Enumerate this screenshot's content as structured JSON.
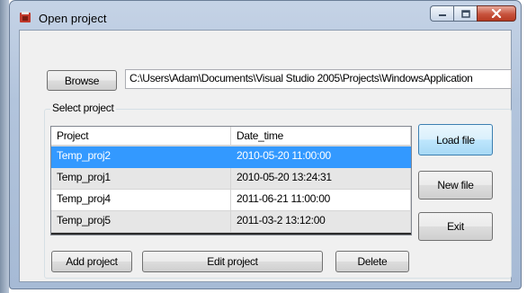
{
  "window": {
    "title": "Open project",
    "icon": "app-icon",
    "minimize_glyph": "–",
    "maximize_glyph": "□",
    "close_glyph": "✕"
  },
  "browse": {
    "button_label": "Browse",
    "path_value": "C:\\Users\\Adam\\Documents\\Visual Studio 2005\\Projects\\WindowsApplication"
  },
  "group": {
    "label": "Select project"
  },
  "table": {
    "columns": [
      "Project",
      "Date_time"
    ],
    "rows": [
      {
        "project": "Temp_proj2",
        "date_time": "2010-05-20 11:00:00",
        "selected": true
      },
      {
        "project": "Temp_proj1",
        "date_time": "2010-05-20 13:24:31",
        "selected": false
      },
      {
        "project": "Temp_proj4",
        "date_time": "2011-06-21 11:00:00",
        "selected": false
      },
      {
        "project": "Temp_proj5",
        "date_time": "2011-03-2 13:12:00",
        "selected": false
      }
    ]
  },
  "side_buttons": {
    "load_label": "Load file",
    "new_label": "New file",
    "exit_label": "Exit"
  },
  "bottom_buttons": {
    "add_label": "Add project",
    "edit_label": "Edit project",
    "delete_label": "Delete"
  },
  "colors": {
    "selection": "#3399ff",
    "close_button": "#c7533d"
  }
}
